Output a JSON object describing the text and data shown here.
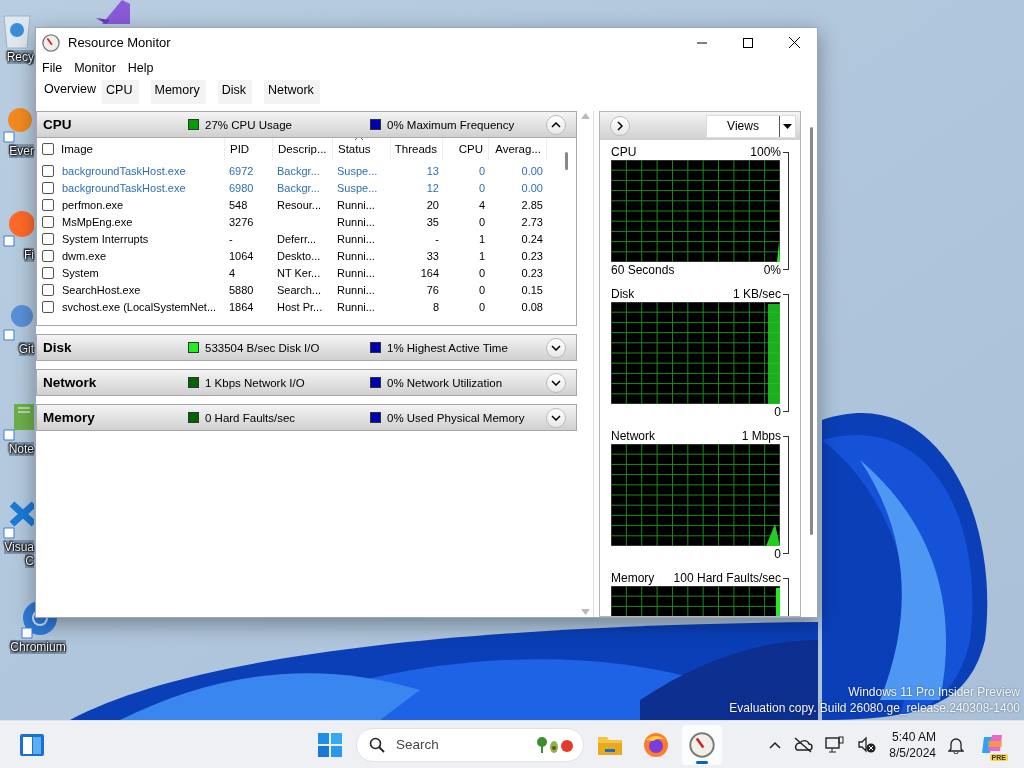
{
  "desktop": {
    "icons": [
      {
        "kind": "recycle",
        "lines": [
          "Recy"
        ]
      },
      {
        "kind": "studio"
      },
      {
        "kind": "everything",
        "lines": [
          "Ever"
        ]
      },
      {
        "kind": "firefox",
        "lines": [
          "Fi"
        ]
      },
      {
        "kind": "git",
        "lines": [
          "Git"
        ]
      },
      {
        "kind": "notepad",
        "lines": [
          "Note"
        ]
      },
      {
        "kind": "visual",
        "lines": [
          "Visua",
          "C"
        ]
      },
      {
        "kind": "chromium",
        "lines": [
          "Chromium"
        ]
      }
    ],
    "watermark": [
      "Windows 11 Pro Insider Preview",
      "Evaluation copy. Build 26080.ge_release.240308-1400"
    ]
  },
  "window": {
    "title": "Resource Monitor",
    "menu": [
      "File",
      "Monitor",
      "Help"
    ],
    "tabs": [
      {
        "label": "Overview",
        "selected": true
      },
      {
        "label": "CPU",
        "selected": false
      },
      {
        "label": "Memory",
        "selected": false
      },
      {
        "label": "Disk",
        "selected": false
      },
      {
        "label": "Network",
        "selected": false
      }
    ],
    "sections": [
      {
        "title": "CPU",
        "expanded": true,
        "legends": [
          {
            "text": "27% CPU Usage",
            "color": "#00a000"
          },
          {
            "text": "0% Maximum Frequency",
            "color": "#0000b0"
          }
        ]
      },
      {
        "title": "Disk",
        "expanded": false,
        "legends": [
          {
            "text": "533504 B/sec Disk I/O",
            "color": "#22ee22"
          },
          {
            "text": "1% Highest Active Time",
            "color": "#0000b0"
          }
        ]
      },
      {
        "title": "Network",
        "expanded": false,
        "legends": [
          {
            "text": "1 Kbps Network I/O",
            "color": "#006400"
          },
          {
            "text": "0% Network Utilization",
            "color": "#0000b0"
          }
        ]
      },
      {
        "title": "Memory",
        "expanded": false,
        "legends": [
          {
            "text": "0 Hard Faults/sec",
            "color": "#006400"
          },
          {
            "text": "0% Used Physical Memory",
            "color": "#0000b0"
          }
        ]
      }
    ],
    "processes": {
      "columns": [
        {
          "label": "Image",
          "sorted": false
        },
        {
          "label": "PID",
          "sorted": false
        },
        {
          "label": "Descrip...",
          "sorted": false
        },
        {
          "label": "Status",
          "sorted": true
        },
        {
          "label": "Threads",
          "sorted": false
        },
        {
          "label": "CPU",
          "sorted": false
        },
        {
          "label": "Averag...",
          "sorted": false
        }
      ],
      "rows": [
        {
          "checked": false,
          "suspended": true,
          "cells": [
            "backgroundTaskHost.exe",
            "6972",
            "Backgr...",
            "Suspe...",
            "13",
            "0",
            "0.00"
          ]
        },
        {
          "checked": false,
          "suspended": true,
          "cells": [
            "backgroundTaskHost.exe",
            "6980",
            "Backgr...",
            "Suspe...",
            "12",
            "0",
            "0.00"
          ]
        },
        {
          "checked": false,
          "suspended": false,
          "cells": [
            "perfmon.exe",
            "548",
            "Resour...",
            "Runni...",
            "20",
            "4",
            "2.85"
          ]
        },
        {
          "checked": false,
          "suspended": false,
          "cells": [
            "MsMpEng.exe",
            "3276",
            "",
            "Runni...",
            "35",
            "0",
            "2.73"
          ]
        },
        {
          "checked": false,
          "suspended": false,
          "cells": [
            "System Interrupts",
            "-",
            "Deferr...",
            "Runni...",
            "-",
            "1",
            "0.24"
          ]
        },
        {
          "checked": false,
          "suspended": false,
          "cells": [
            "dwm.exe",
            "1064",
            "Deskto...",
            "Runni...",
            "33",
            "1",
            "0.23"
          ]
        },
        {
          "checked": false,
          "suspended": false,
          "cells": [
            "System",
            "4",
            "NT Ker...",
            "Runni...",
            "164",
            "0",
            "0.23"
          ]
        },
        {
          "checked": false,
          "suspended": false,
          "cells": [
            "SearchHost.exe",
            "5880",
            "Search...",
            "Runni...",
            "76",
            "0",
            "0.15"
          ]
        },
        {
          "checked": false,
          "suspended": false,
          "cells": [
            "svchost.exe (LocalSystemNet...",
            "1864",
            "Host Pr...",
            "Runni...",
            "8",
            "0",
            "0.08"
          ]
        }
      ]
    },
    "views_button": "Views",
    "graphs": [
      {
        "kind": "cpu",
        "title": "CPU",
        "max": "100%",
        "span": "60 Seconds",
        "min": "0%"
      },
      {
        "kind": "disk",
        "title": "Disk",
        "max": "1 KB/sec",
        "min": "0"
      },
      {
        "kind": "network",
        "title": "Network",
        "max": "1 Mbps",
        "min": "0"
      },
      {
        "kind": "memory",
        "title": "Memory",
        "max": "100 Hard Faults/sec"
      }
    ]
  },
  "taskbar": {
    "search": {
      "placeholder": "Search"
    },
    "apps": [
      {
        "kind": "explorer",
        "active": false
      },
      {
        "kind": "firefox",
        "active": false
      },
      {
        "kind": "resmon",
        "active": true
      }
    ],
    "time": "5:40 AM",
    "date": "8/5/2024",
    "copilot_badge": "PRE"
  }
}
